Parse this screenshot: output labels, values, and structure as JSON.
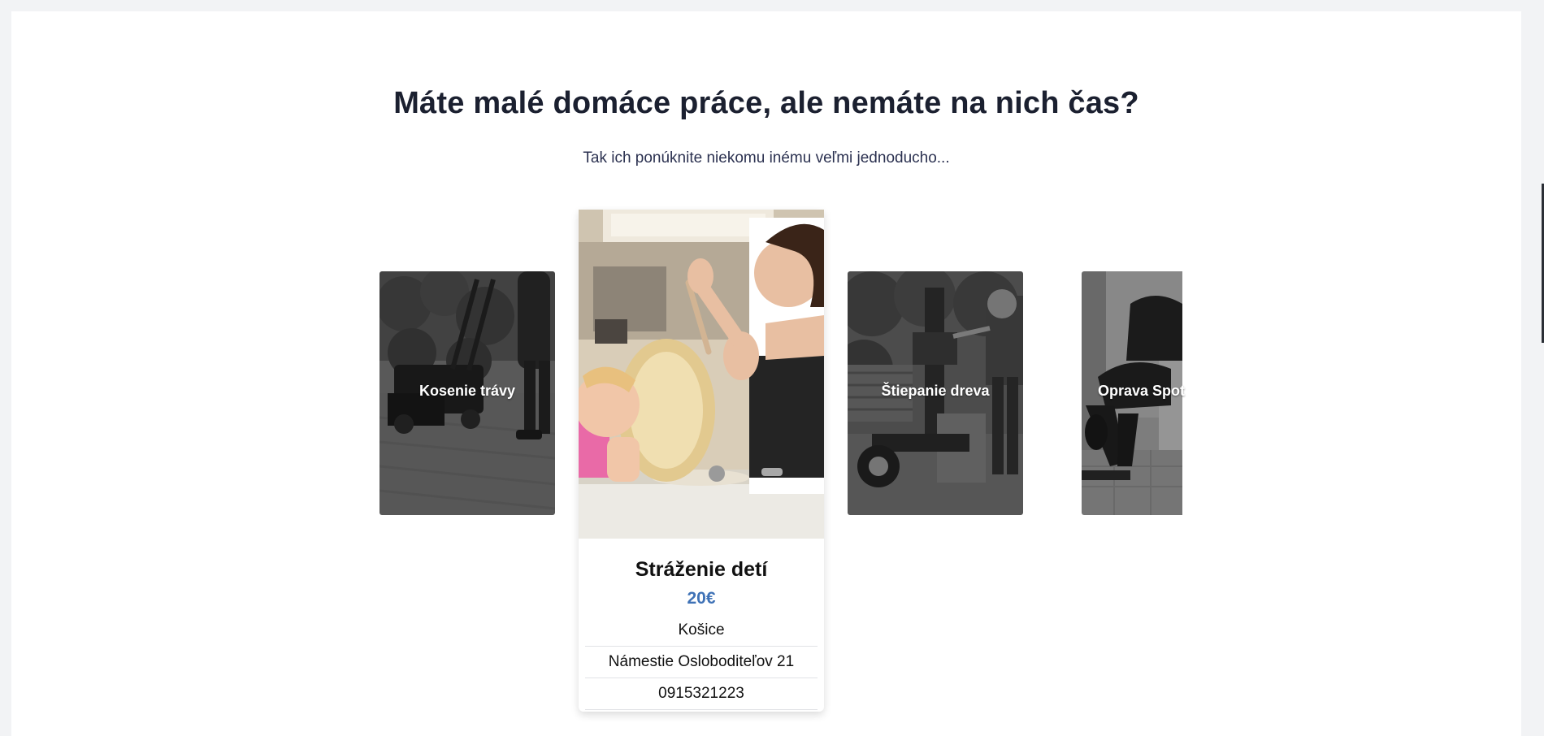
{
  "hero": {
    "title": "Máte malé domáce práce, ale nemáte na nich čas?",
    "subtitle": "Tak ich ponúknite niekomu inému veľmi jednoducho..."
  },
  "cards": [
    {
      "label": "Kosenie trávy"
    },
    {
      "label": "Štiepanie dreva"
    },
    {
      "label": "Oprava Spot"
    }
  ],
  "featured": {
    "title": "Stráženie detí",
    "price": "20€",
    "city": "Košice",
    "address": "Námestie Osloboditeľov 21",
    "phone": "0915321223"
  }
}
